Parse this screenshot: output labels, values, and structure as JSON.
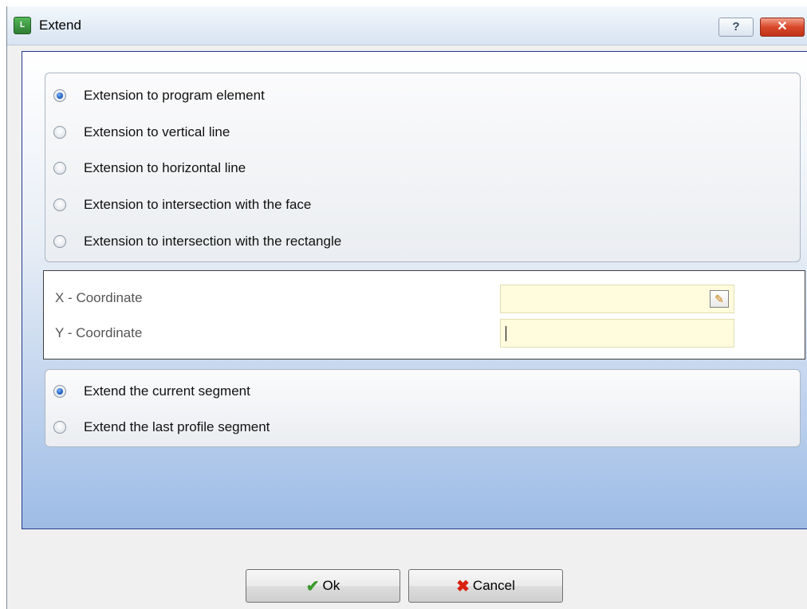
{
  "window": {
    "title": "Extend",
    "help_label": "?",
    "close_label": "✕",
    "app_icon_text": "L"
  },
  "extension_options": [
    {
      "label": "Extension to program element",
      "checked": true
    },
    {
      "label": "Extension to vertical line",
      "checked": false
    },
    {
      "label": "Extension to horizontal line",
      "checked": false
    },
    {
      "label": "Extension to intersection with the face",
      "checked": false
    },
    {
      "label": "Extension to intersection with the rectangle",
      "checked": false
    }
  ],
  "coordinates": {
    "x_label": "X - Coordinate",
    "x_value": "",
    "y_label": "Y - Coordinate",
    "y_value": ""
  },
  "extend_options": [
    {
      "label": "Extend the current segment",
      "checked": true
    },
    {
      "label": "Extend the last profile segment",
      "checked": false
    }
  ],
  "buttons": {
    "ok_label": "Ok",
    "cancel_label": "Cancel"
  },
  "icons": {
    "app": "app-icon",
    "help": "help-icon",
    "close": "close-icon",
    "edit": "edit-icon",
    "ok": "check-icon",
    "cancel": "x-icon"
  }
}
